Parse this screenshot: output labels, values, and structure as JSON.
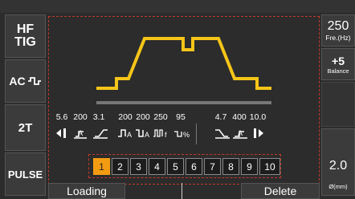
{
  "left_buttons": {
    "hf_tig_line1": "HF",
    "hf_tig_line2": "TIG",
    "ac_label": "AC",
    "trigger_mode": "2T",
    "pulse": "PULSE"
  },
  "right_panel": {
    "frequency_value": "250",
    "frequency_unit": "Fre.(Hz)",
    "balance_value": "+5",
    "balance_label": "Balance",
    "diameter_value": "2.0",
    "diameter_unit": "Ø(mm)"
  },
  "params": [
    "5.6",
    "200",
    "3.1",
    "200",
    "200",
    "250",
    "95",
    "4.7",
    "400",
    "10.0"
  ],
  "param_icon_text": {
    "pulse_a1": "A",
    "pulse_a2": "A",
    "pulse_f": "f",
    "balance_pct": "%",
    "crater_a": "A",
    "start_a": "A"
  },
  "memory": {
    "slots": [
      "1",
      "2",
      "3",
      "4",
      "5",
      "6",
      "7",
      "8",
      "9",
      "10"
    ],
    "active_index": 0
  },
  "bottom": {
    "loading": "Loading",
    "delete": "Delete"
  },
  "colors": {
    "accent": "#f39c12",
    "waveform": "#f5c518",
    "border_dash": "#c0392b",
    "background": "#2c2c2c"
  }
}
